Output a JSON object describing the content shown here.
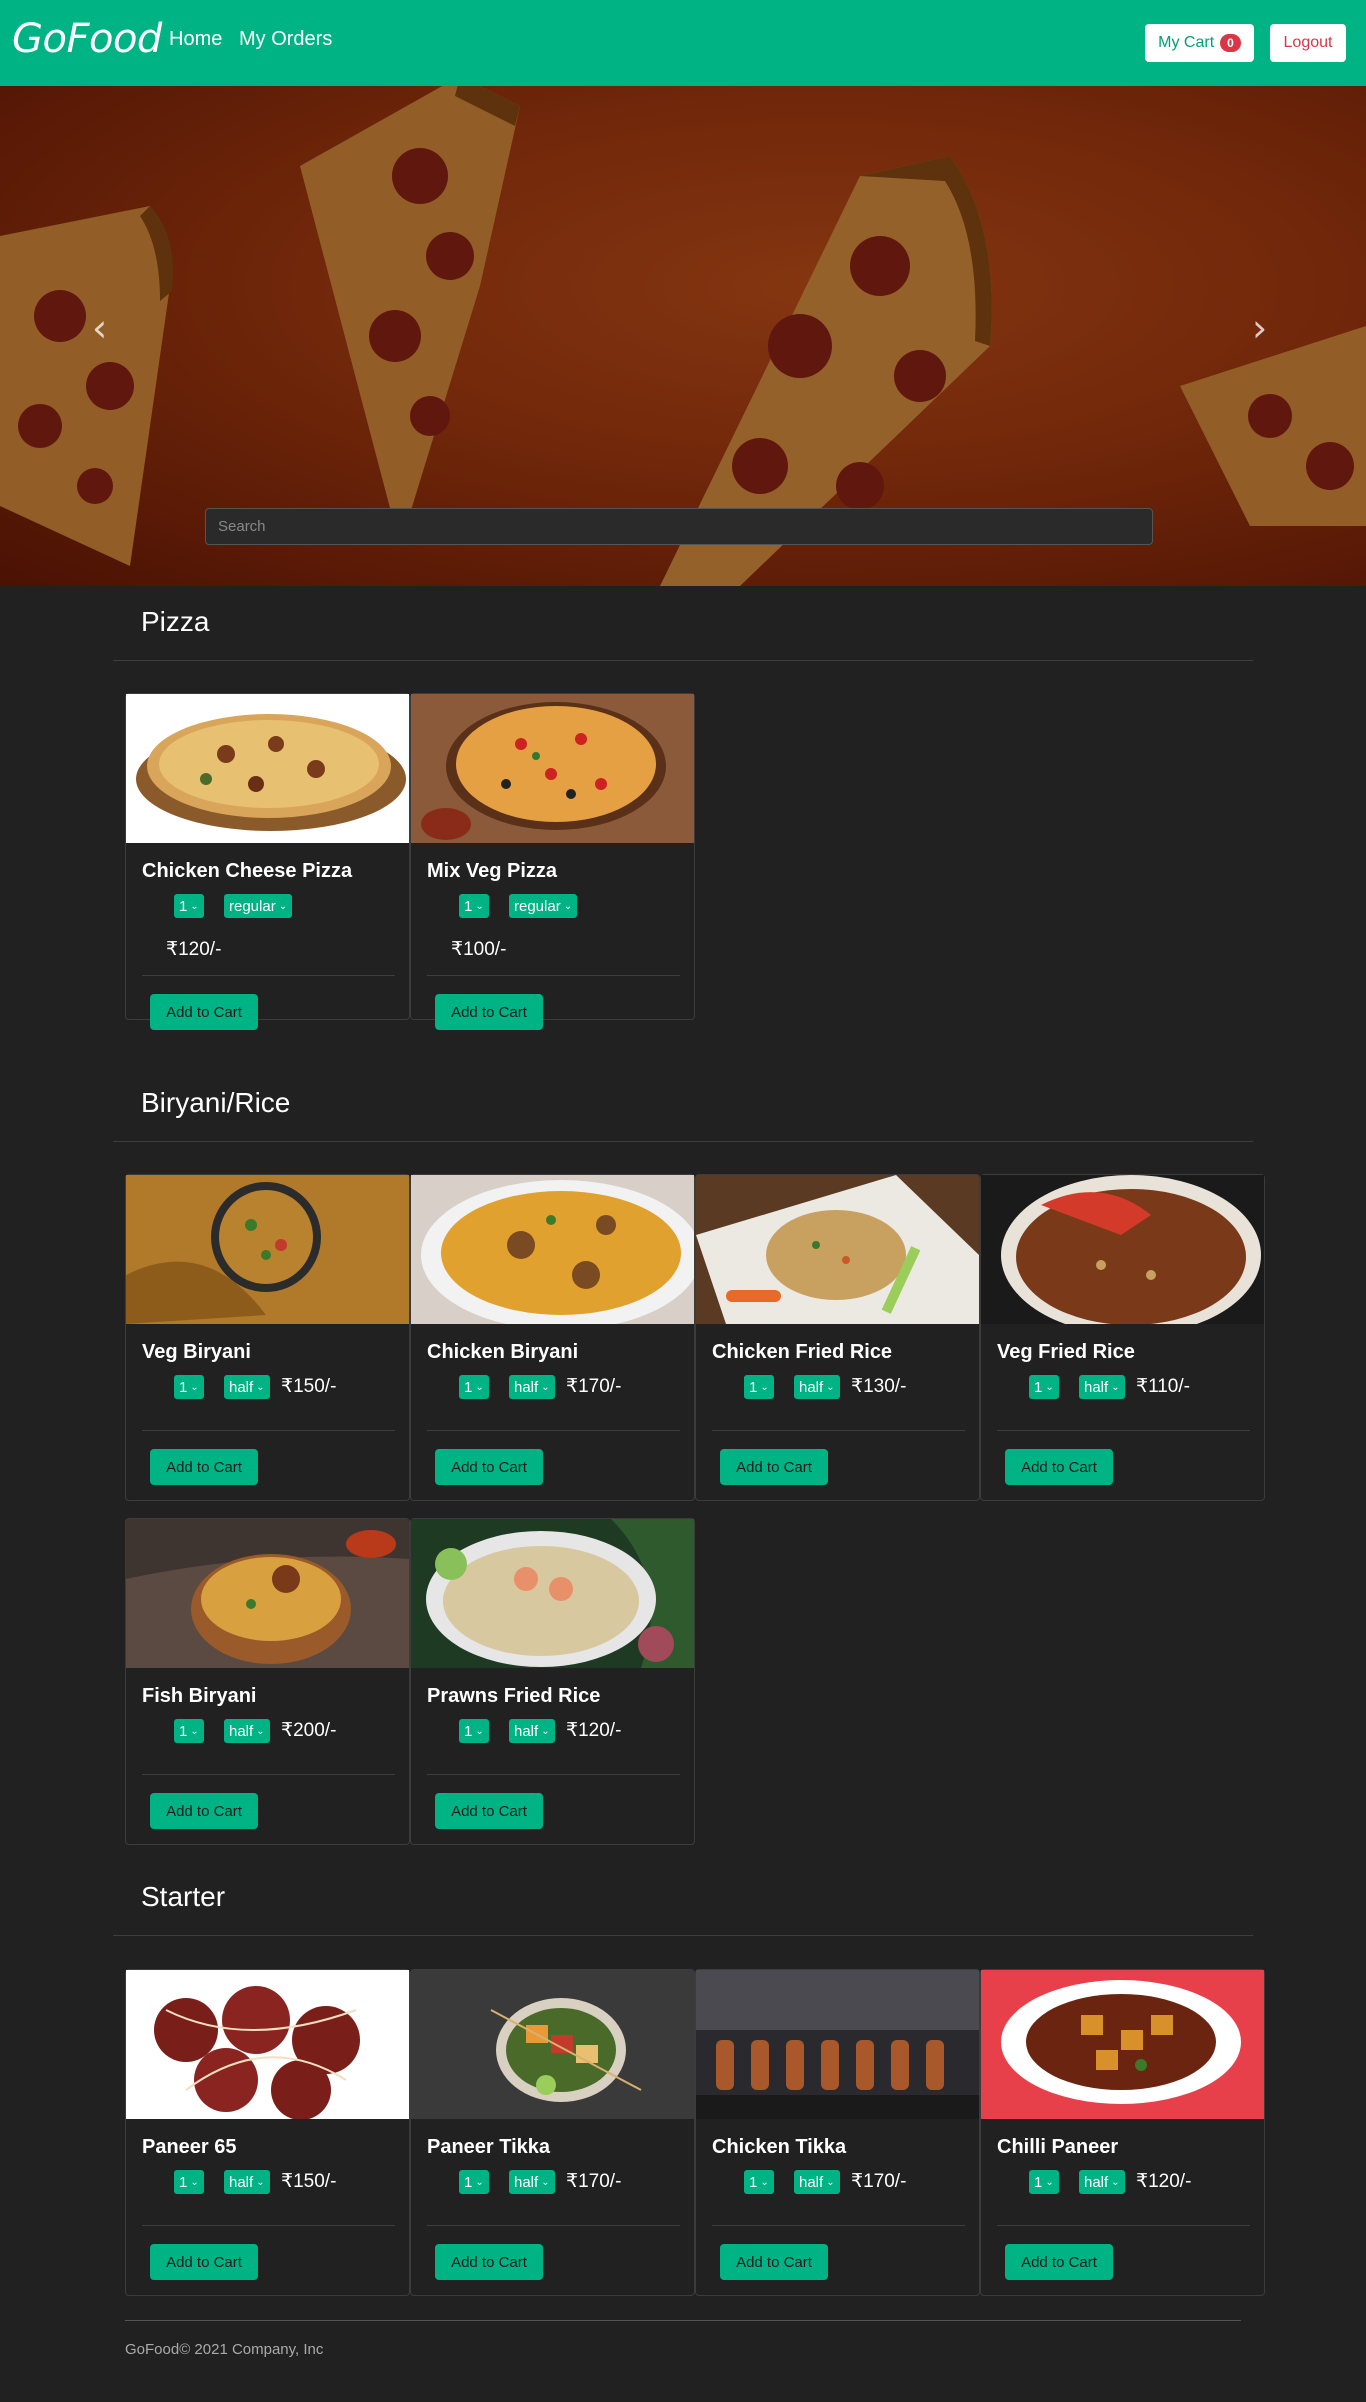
{
  "navbar": {
    "brand": "GoFood",
    "links": [
      "Home",
      "My Orders"
    ],
    "cart_label": "My Cart",
    "cart_count": "0",
    "logout_label": "Logout"
  },
  "hero": {
    "search_placeholder": "Search",
    "prev_icon": "chevron-left-icon",
    "next_icon": "chevron-right-icon"
  },
  "colors": {
    "brand": "#00b385",
    "background": "#212121",
    "danger": "#dc3545"
  },
  "categories": [
    {
      "name": "Pizza",
      "items": [
        {
          "name": "Chicken Cheese Pizza",
          "qty": "1",
          "size": "regular",
          "price": "₹120/-",
          "add_label": "Add to Cart"
        },
        {
          "name": "Mix Veg Pizza",
          "qty": "1",
          "size": "regular",
          "price": "₹100/-",
          "add_label": "Add to Cart"
        }
      ]
    },
    {
      "name": "Biryani/Rice",
      "items": [
        {
          "name": "Veg Biryani",
          "qty": "1",
          "size": "half",
          "price": "₹150/-",
          "add_label": "Add to Cart"
        },
        {
          "name": "Chicken Biryani",
          "qty": "1",
          "size": "half",
          "price": "₹170/-",
          "add_label": "Add to Cart"
        },
        {
          "name": "Chicken Fried Rice",
          "qty": "1",
          "size": "half",
          "price": "₹130/-",
          "add_label": "Add to Cart"
        },
        {
          "name": "Veg Fried Rice",
          "qty": "1",
          "size": "half",
          "price": "₹110/-",
          "add_label": "Add to Cart"
        },
        {
          "name": "Fish Biryani",
          "qty": "1",
          "size": "half",
          "price": "₹200/-",
          "add_label": "Add to Cart"
        },
        {
          "name": "Prawns Fried Rice",
          "qty": "1",
          "size": "half",
          "price": "₹120/-",
          "add_label": "Add to Cart"
        }
      ]
    },
    {
      "name": "Starter",
      "items": [
        {
          "name": "Paneer 65",
          "qty": "1",
          "size": "half",
          "price": "₹150/-",
          "add_label": "Add to Cart"
        },
        {
          "name": "Paneer Tikka",
          "qty": "1",
          "size": "half",
          "price": "₹170/-",
          "add_label": "Add to Cart"
        },
        {
          "name": "Chicken Tikka",
          "qty": "1",
          "size": "half",
          "price": "₹170/-",
          "add_label": "Add to Cart"
        },
        {
          "name": "Chilli Paneer",
          "qty": "1",
          "size": "half",
          "price": "₹120/-",
          "add_label": "Add to Cart"
        }
      ]
    }
  ],
  "footer": {
    "text": "GoFood© 2021 Company, Inc"
  }
}
